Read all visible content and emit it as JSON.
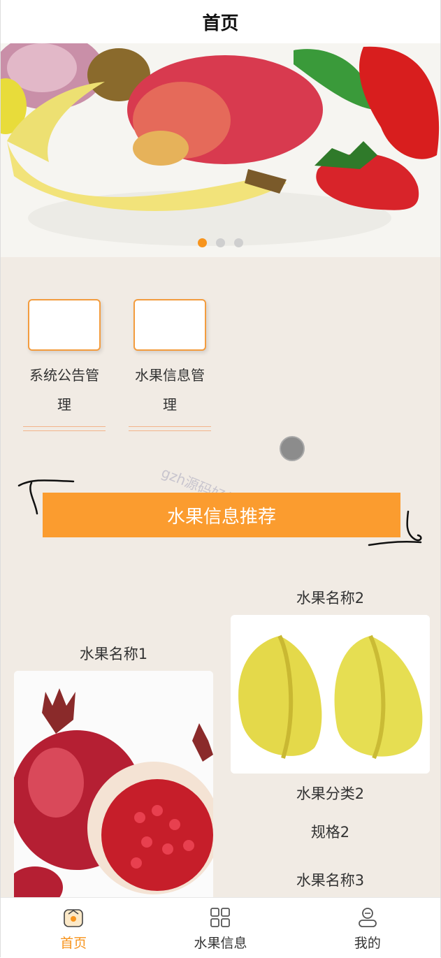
{
  "header": {
    "title": "首页"
  },
  "banner": {
    "slides": 3,
    "active_slide": 1
  },
  "nav": {
    "items": [
      {
        "label": "系统公告管理"
      },
      {
        "label": "水果信息管理"
      }
    ]
  },
  "watermark": "gzh源码好优",
  "recommend": {
    "title": "水果信息推荐"
  },
  "products": {
    "left": {
      "name": "水果名称1"
    },
    "right": {
      "name": "水果名称2",
      "category": "水果分类2",
      "spec": "规格2"
    },
    "right_next": {
      "name": "水果名称3"
    }
  },
  "tabbar": {
    "items": [
      {
        "label": "首页",
        "icon": "home-icon",
        "active": true
      },
      {
        "label": "水果信息",
        "icon": "grid-icon",
        "active": false
      },
      {
        "label": "我的",
        "icon": "user-icon",
        "active": false
      }
    ]
  },
  "colors": {
    "accent": "#f7941d",
    "content_bg": "#f1ebe4",
    "banner_orange": "#fb9c2f"
  }
}
